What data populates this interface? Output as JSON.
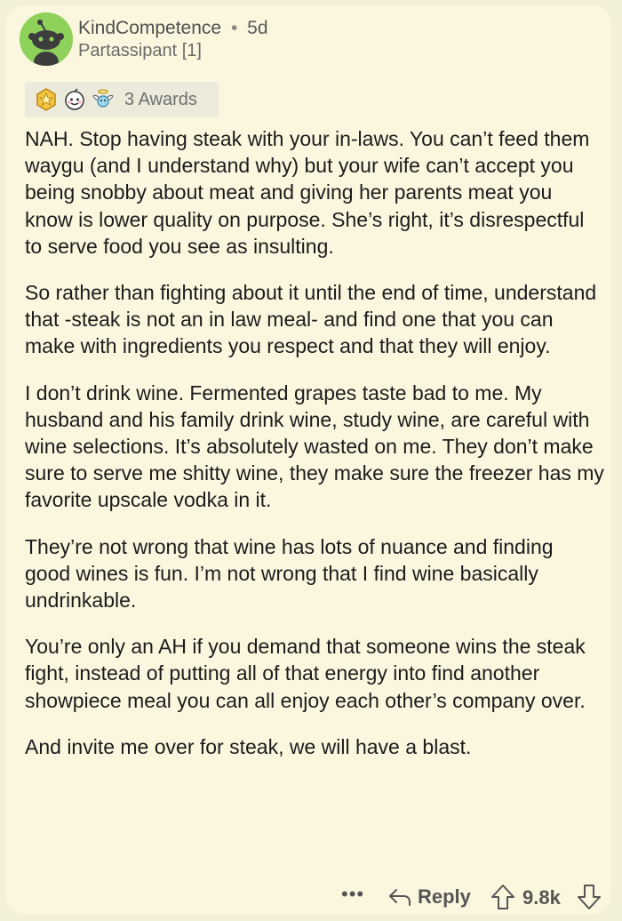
{
  "comment": {
    "username": "KindCompetence",
    "separator": "•",
    "age": "5d",
    "flair": "Partassipant [1]",
    "awards": {
      "icons": [
        "gold-star-award-icon",
        "wholesome-seal-award-icon",
        "angel-wings-award-icon"
      ],
      "count_label": "3 Awards"
    },
    "paragraphs": [
      "NAH. Stop having steak with your in-laws. You can’t feed them waygu (and I understand why) but your wife can’t accept you being snobby about meat and giving her parents meat you know is lower quality on purpose. She’s right, it’s disrespectful to serve food you see as insulting.",
      "So rather than fighting about it until the end of time, understand that -steak is not an in law meal- and find one that you can make with ingredients you respect and that they will enjoy.",
      "I don’t drink wine. Fermented grapes taste bad to me. My husband and his family drink wine, study wine, are careful with wine selections. It’s absolutely wasted on me. They don’t make sure to serve me shitty wine, they make sure the freezer has my favorite upscale vodka in it.",
      "They’re not wrong that wine has lots of nuance and finding good wines is fun. I’m not wrong that I find wine basically undrinkable.",
      "You’re only an AH if you demand that someone wins the steak fight, instead of putting all of that energy into find another showpiece meal you can all enjoy each other’s company over.",
      "And invite me over for steak, we will have a blast."
    ],
    "actions": {
      "more_label": "•••",
      "reply_label": "Reply",
      "score": "9.8k"
    }
  },
  "colors": {
    "background": "#fbf7df",
    "avatar": "#8ed25b",
    "text": "#1c1c1c",
    "meta": "#5a5a5a"
  }
}
